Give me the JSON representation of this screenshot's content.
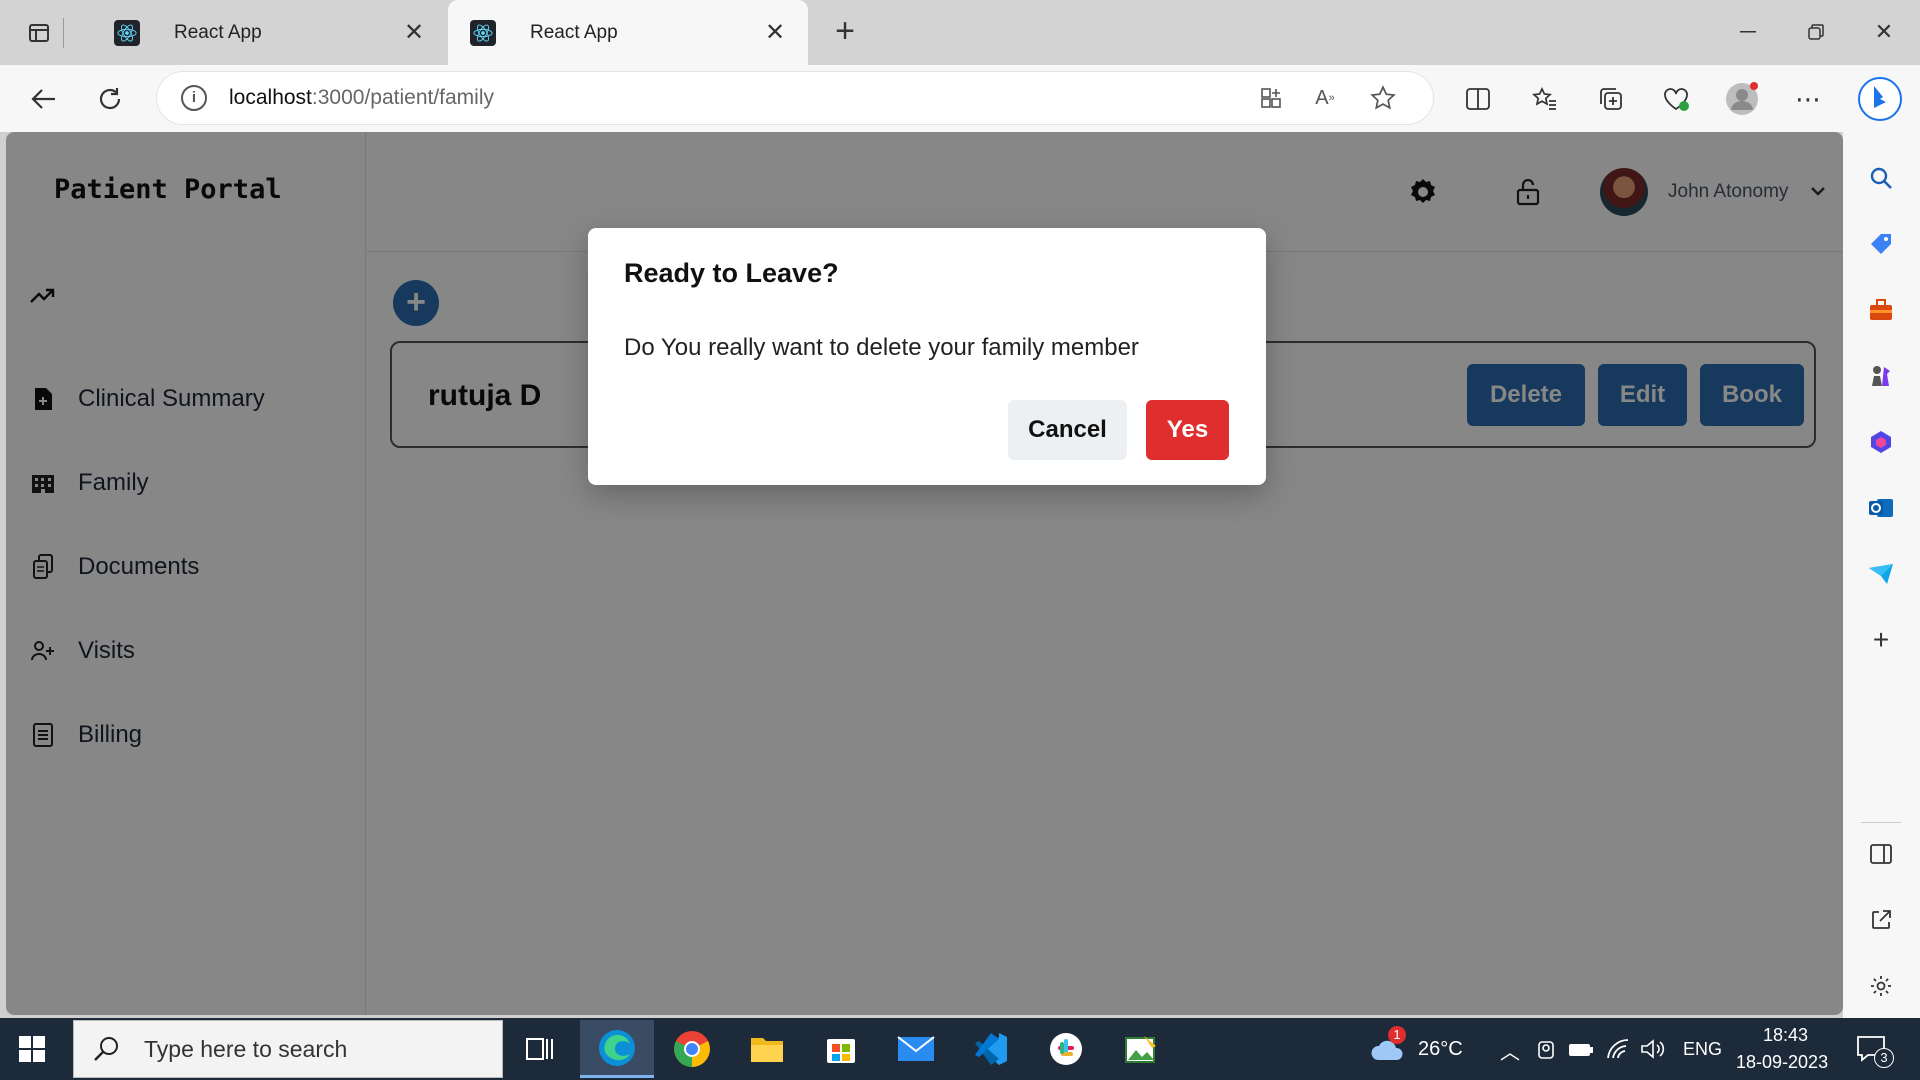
{
  "browser": {
    "tabs": [
      {
        "title": "React App",
        "active": false
      },
      {
        "title": "React App",
        "active": true
      }
    ],
    "url_host": "localhost",
    "url_path": ":3000/patient/family"
  },
  "app": {
    "brand": "Patient Portal",
    "nav": [
      {
        "label": "Clinical Summary",
        "icon": "document-plus-icon"
      },
      {
        "label": "Family",
        "icon": "building-icon"
      },
      {
        "label": "Documents",
        "icon": "documents-icon"
      },
      {
        "label": "Visits",
        "icon": "user-plus-icon"
      },
      {
        "label": "Billing",
        "icon": "list-icon"
      }
    ],
    "user_name": "John Atonomy",
    "member": {
      "name": "rutuja D",
      "actions": [
        "Delete",
        "Edit",
        "Book"
      ]
    },
    "add_label": "+"
  },
  "modal": {
    "title": "Ready to Leave?",
    "body": "Do You really want to delete your family member",
    "cancel": "Cancel",
    "confirm": "Yes"
  },
  "taskbar": {
    "search_placeholder": "Type here to search",
    "weather_temp": "26°C",
    "weather_badge": "1",
    "language": "ENG",
    "time": "18:43",
    "date": "18-09-2023",
    "notification_count": "3"
  },
  "colors": {
    "primary_button": "#2b6cb0",
    "danger_button": "#e02d2d",
    "overlay": "rgba(0,0,0,0.47)"
  }
}
